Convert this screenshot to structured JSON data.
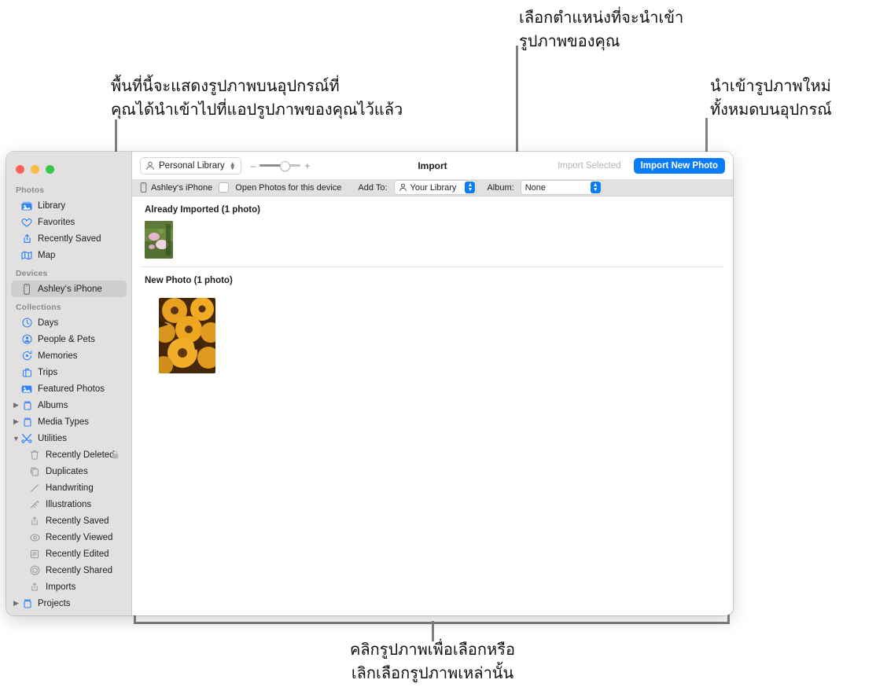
{
  "annotations": [
    {
      "id": "library-area",
      "lines": [
        "พื้นที่นี้จะแสดงรูปภาพบนอุปกรณ์ที่",
        "คุณได้นำเข้าไปที่แอปรูปภาพของคุณไว้แล้ว"
      ]
    },
    {
      "id": "import-destination",
      "lines": [
        "เลือกตำแหน่งที่จะนำเข้า",
        "รูปภาพของคุณ"
      ]
    },
    {
      "id": "import-all-new",
      "lines": [
        "นำเข้ารูปภาพใหม่",
        "ทั้งหมดบนอุปกรณ์"
      ]
    },
    {
      "id": "click-to-select",
      "lines": [
        "คลิกรูปภาพเพื่อเลือกหรือ",
        "เลิกเลือกรูปภาพเหล่านั้น"
      ]
    }
  ],
  "window": {
    "toolbar": {
      "library_popup": "Personal Library",
      "zoom_minus": "–",
      "zoom_plus": "+",
      "title": "Import",
      "import_selected": "Import Selected",
      "import_new_photo": "Import New Photo"
    },
    "subbar": {
      "device": "Ashley‘s iPhone",
      "open_photos_label": "Open Photos for this device",
      "add_to_label": "Add To:",
      "add_to_value": "Your Library",
      "album_label": "Album:",
      "album_value": "None"
    },
    "sections": [
      {
        "heading": "Already Imported (1 photo)",
        "photos": [
          "pink-flowers-thumbnail"
        ]
      },
      {
        "heading": "New Photo (1 photo)",
        "photos": [
          "orange-rudbeckia-flowers-thumbnail"
        ]
      }
    ]
  },
  "sidebar": {
    "groups": [
      {
        "title": "Photos",
        "items": [
          {
            "label": "Library",
            "icon": "library-icon",
            "selected": false
          },
          {
            "label": "Favorites",
            "icon": "heart-icon",
            "selected": false
          },
          {
            "label": "Recently Saved",
            "icon": "recently-saved-icon",
            "selected": false
          },
          {
            "label": "Map",
            "icon": "map-icon",
            "selected": false
          }
        ]
      },
      {
        "title": "Devices",
        "items": [
          {
            "label": "Ashley‘s iPhone",
            "icon": "iphone-icon",
            "selected": true
          }
        ]
      },
      {
        "title": "Collections",
        "items": [
          {
            "label": "Days",
            "icon": "clock-icon",
            "selected": false
          },
          {
            "label": "People & Pets",
            "icon": "person-icon",
            "selected": false
          },
          {
            "label": "Memories",
            "icon": "memories-icon",
            "selected": false
          },
          {
            "label": "Trips",
            "icon": "trips-icon",
            "selected": false
          },
          {
            "label": "Featured Photos",
            "icon": "featured-icon",
            "selected": false
          },
          {
            "label": "Albums",
            "icon": "album-icon",
            "twisty": "collapsed"
          },
          {
            "label": "Media Types",
            "icon": "album-icon",
            "twisty": "collapsed"
          },
          {
            "label": "Utilities",
            "icon": "utilities-icon",
            "twisty": "expanded"
          },
          {
            "label": "Recently Deleted",
            "icon": "trash-icon",
            "sub": true,
            "trailing": "lock-icon"
          },
          {
            "label": "Duplicates",
            "icon": "duplicates-icon",
            "sub": true
          },
          {
            "label": "Handwriting",
            "icon": "handwriting-icon",
            "sub": true
          },
          {
            "label": "Illustrations",
            "icon": "illustrations-icon",
            "sub": true
          },
          {
            "label": "Recently Saved",
            "icon": "recently-saved-icon",
            "sub": true
          },
          {
            "label": "Recently Viewed",
            "icon": "viewed-icon",
            "sub": true
          },
          {
            "label": "Recently Edited",
            "icon": "edited-icon",
            "sub": true
          },
          {
            "label": "Recently Shared",
            "icon": "shared-icon",
            "sub": true
          },
          {
            "label": "Imports",
            "icon": "recently-saved-icon",
            "sub": true
          },
          {
            "label": "Projects",
            "icon": "album-icon",
            "twisty": "collapsed"
          }
        ]
      }
    ]
  },
  "colors": {
    "accent": "#0a7cf8",
    "sidebar_bg": "#e2e1e0",
    "selected_bg": "#cfcecd",
    "callout_line": "#808080"
  }
}
